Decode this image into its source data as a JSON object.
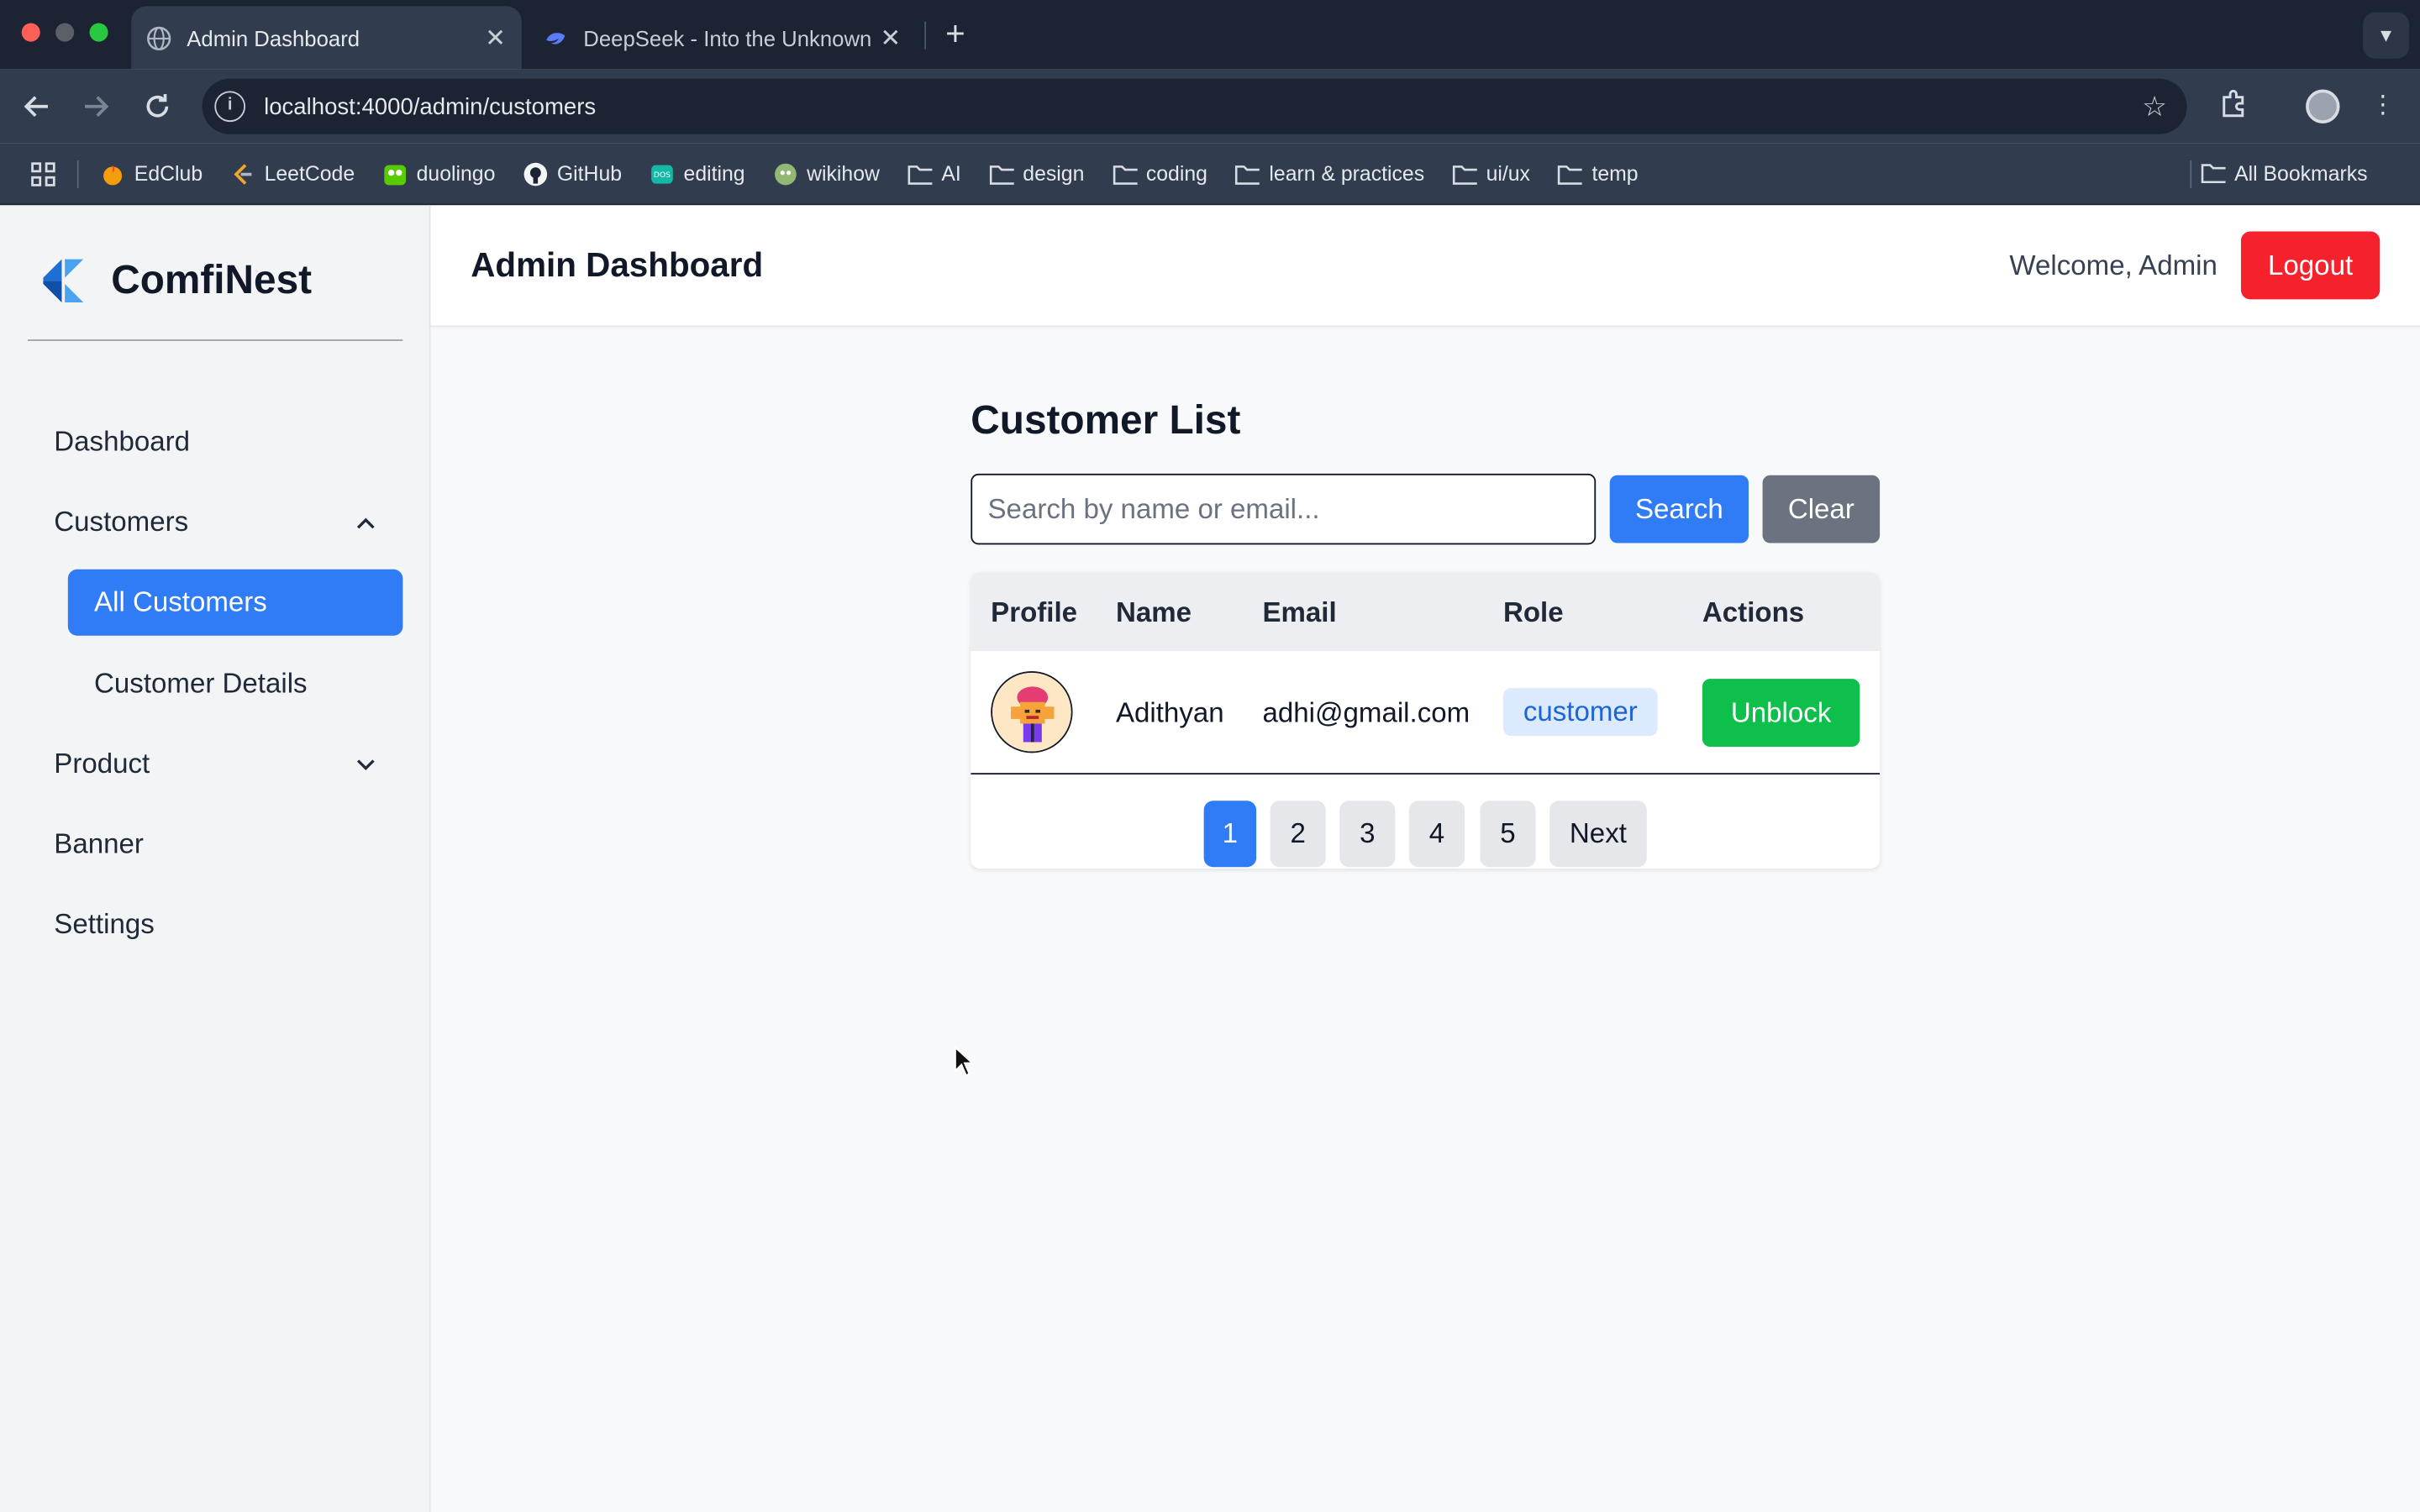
{
  "browser": {
    "tabs": [
      {
        "title": "Admin Dashboard",
        "active": true,
        "icon": "globe-icon"
      },
      {
        "title": "DeepSeek - Into the Unknown",
        "active": false,
        "icon": "deepseek-whale-icon"
      }
    ],
    "url": "localhost:4000/admin/customers",
    "bookmarks": [
      {
        "label": "EdClub",
        "icon": "edclub-icon"
      },
      {
        "label": "LeetCode",
        "icon": "leetcode-icon"
      },
      {
        "label": "duolingo",
        "icon": "duolingo-owl-icon"
      },
      {
        "label": "GitHub",
        "icon": "github-icon"
      },
      {
        "label": "editing",
        "icon": "editing-icon"
      },
      {
        "label": "wikihow",
        "icon": "wikihow-icon"
      },
      {
        "label": "AI",
        "icon": "folder-icon"
      },
      {
        "label": "design",
        "icon": "folder-icon"
      },
      {
        "label": "coding",
        "icon": "folder-icon"
      },
      {
        "label": "learn & practices",
        "icon": "folder-icon"
      },
      {
        "label": "ui/ux",
        "icon": "folder-icon"
      },
      {
        "label": "temp",
        "icon": "folder-icon"
      }
    ],
    "all_bookmarks": "All Bookmarks"
  },
  "brand": {
    "name": "ComfiNest",
    "accent": "#1d6fd6"
  },
  "sidebar": {
    "items": [
      {
        "label": "Dashboard"
      },
      {
        "label": "Customers",
        "expanded": true
      },
      {
        "label": "All Customers",
        "active": true
      },
      {
        "label": "Customer Details"
      },
      {
        "label": "Product",
        "expanded": false
      },
      {
        "label": "Banner"
      },
      {
        "label": "Settings"
      }
    ]
  },
  "header": {
    "title": "Admin Dashboard",
    "welcome": "Welcome, Admin",
    "logout": "Logout",
    "logout_color": "#f5222d"
  },
  "main": {
    "title": "Customer List",
    "search": {
      "placeholder": "Search by name or email...",
      "value": ""
    },
    "search_button": "Search",
    "clear_button": "Clear",
    "table": {
      "columns": [
        "Profile",
        "Name",
        "Email",
        "Role",
        "Actions"
      ],
      "rows": [
        {
          "name": "Adithyan",
          "email": "adhi@gmail.com",
          "role": "customer",
          "action": "Unblock",
          "avatar": "avatar-icon"
        }
      ]
    },
    "pagination": {
      "pages": [
        "1",
        "2",
        "3",
        "4",
        "5"
      ],
      "current": "1",
      "next": "Next"
    }
  },
  "colors": {
    "primary": "#2f7cf6",
    "success": "#0fbf4b",
    "muted": "#6b7280"
  }
}
